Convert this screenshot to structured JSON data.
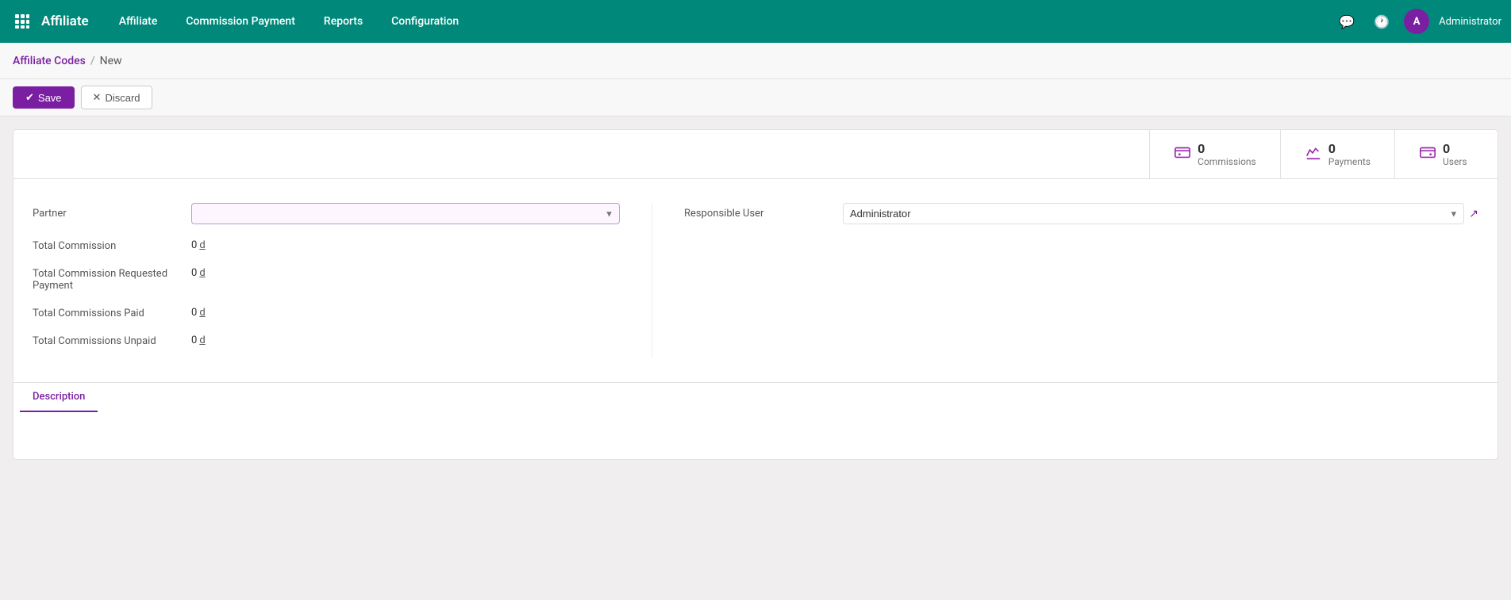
{
  "navbar": {
    "app_title": "Affiliate",
    "grid_icon": "grid-icon",
    "menu_items": [
      {
        "label": "Affiliate",
        "id": "affiliate"
      },
      {
        "label": "Commission Payment",
        "id": "commission-payment"
      },
      {
        "label": "Reports",
        "id": "reports"
      },
      {
        "label": "Configuration",
        "id": "configuration"
      }
    ],
    "username": "Administrator",
    "avatar_letter": "A"
  },
  "breadcrumb": {
    "parent_label": "Affiliate Codes",
    "separator": "/",
    "current_label": "New"
  },
  "actions": {
    "save_label": "Save",
    "discard_label": "Discard"
  },
  "stats": [
    {
      "icon": "💵",
      "number": "0",
      "label": "Commissions",
      "id": "commissions"
    },
    {
      "icon": "✏️",
      "number": "0",
      "label": "Payments",
      "id": "payments"
    },
    {
      "icon": "💵",
      "number": "0",
      "label": "Users",
      "id": "users"
    }
  ],
  "form": {
    "partner_label": "Partner",
    "partner_value": "",
    "partner_placeholder": "",
    "responsible_user_label": "Responsible User",
    "responsible_user_value": "Administrator",
    "total_commission_label": "Total Commission",
    "total_commission_value": "0",
    "total_commission_currency": "d",
    "total_commission_requested_label": "Total Commission Requested Payment",
    "total_commission_requested_value": "0",
    "total_commission_requested_currency": "d",
    "total_commissions_paid_label": "Total Commissions Paid",
    "total_commissions_paid_value": "0",
    "total_commissions_paid_currency": "d",
    "total_commissions_unpaid_label": "Total Commissions Unpaid",
    "total_commissions_unpaid_value": "0",
    "total_commissions_unpaid_currency": "d"
  },
  "tabs": [
    {
      "label": "Description",
      "active": true
    }
  ]
}
